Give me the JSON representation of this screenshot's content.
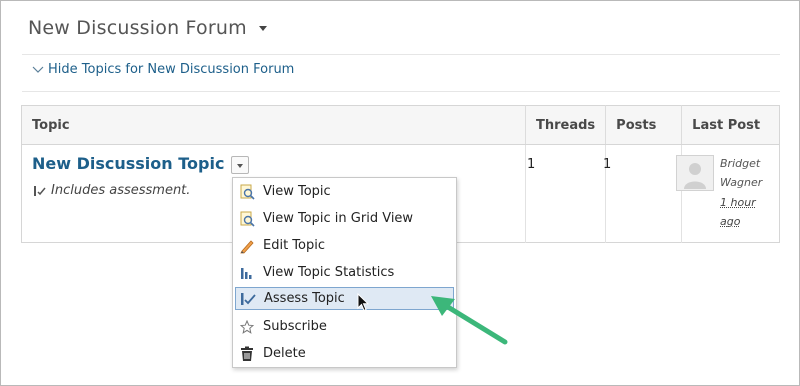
{
  "forum": {
    "title": "New Discussion Forum",
    "hide_topics_link": "Hide Topics for New Discussion Forum"
  },
  "table": {
    "headers": [
      "Topic",
      "Threads",
      "Posts",
      "Last Post"
    ],
    "row": {
      "topic_name": "New Discussion Topic",
      "assessment_note": "Includes assessment.",
      "threads": "1",
      "posts": "1",
      "last_post_author": "Bridget Wagner",
      "last_post_time": "1 hour ago"
    }
  },
  "context_menu": {
    "items": [
      {
        "label": "View Topic",
        "icon": "view-topic-icon"
      },
      {
        "label": "View Topic in Grid View",
        "icon": "grid-view-icon"
      },
      {
        "label": "Edit Topic",
        "icon": "pencil-icon"
      },
      {
        "label": "View Topic Statistics",
        "icon": "statistics-icon"
      },
      {
        "label": "Assess Topic",
        "icon": "assess-icon",
        "highlighted": true
      },
      {
        "label": "Subscribe",
        "icon": "star-icon"
      },
      {
        "label": "Delete",
        "icon": "trash-icon"
      }
    ]
  },
  "colors": {
    "link": "#1d5f8a",
    "highlight_bg": "#dfe9f4",
    "highlight_border": "#7ea6cf",
    "annotation_arrow": "#3cb77a"
  }
}
